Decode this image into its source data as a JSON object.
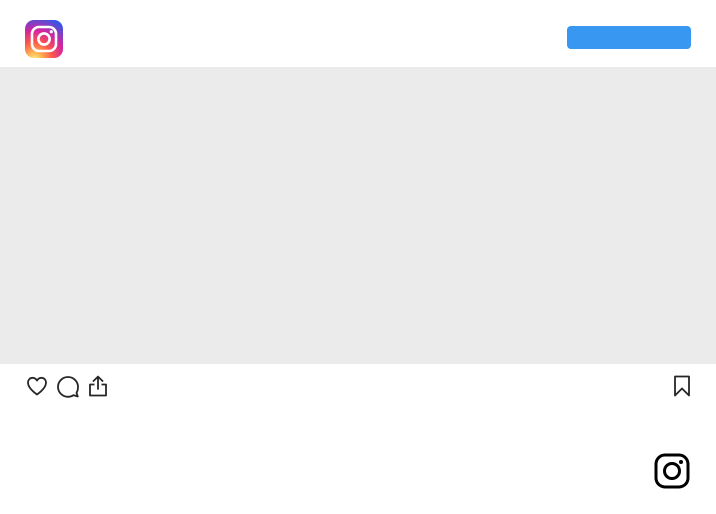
{
  "header": {
    "logo_icon": "instagram-color-logo-icon",
    "cta_label": "",
    "cta_color": "#3897f0"
  },
  "media": {
    "placeholder_color": "#ebebeb"
  },
  "actions": {
    "icons": [
      "heart-icon",
      "comment-icon",
      "share-icon",
      "bookmark-icon"
    ]
  },
  "footer": {
    "logo_icon": "instagram-glyph-icon"
  }
}
